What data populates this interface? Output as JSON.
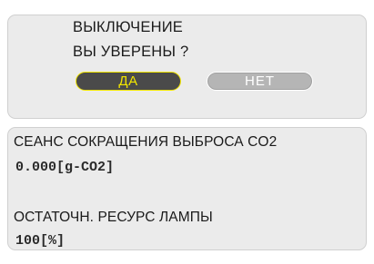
{
  "dialog": {
    "title": "ВЫКЛЮЧЕНИЕ",
    "question": "ВЫ УВЕРЕНЫ ?",
    "yes_label": "ДА",
    "no_label": "НЕТ",
    "selected_button": "yes"
  },
  "info": {
    "co2_label": "СЕАНС СОКРАЩЕНИЯ ВЫБРОСА CO2",
    "co2_value": "0.000[g-CO2]",
    "lamp_label": "ОСТАТОЧН. РЕСУРС ЛАМПЫ",
    "lamp_value": "100[%]"
  },
  "colors": {
    "panel_bg": "#ebebeb",
    "selected_button_bg": "#4a4a4a",
    "selected_button_text": "#f2e600",
    "unselected_button_bg": "#b5b5b5",
    "unselected_button_text": "#ffffff"
  }
}
